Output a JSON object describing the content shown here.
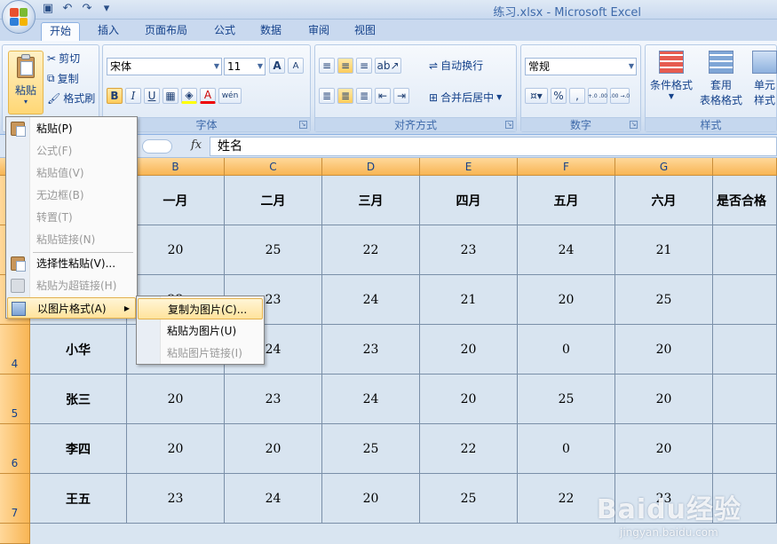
{
  "window": {
    "title": "练习.xlsx - Microsoft Excel"
  },
  "tabs": [
    "开始",
    "插入",
    "页面布局",
    "公式",
    "数据",
    "审阅",
    "视图"
  ],
  "ribbon": {
    "clipboard": {
      "paste_label": "粘贴",
      "cut_label": "剪切",
      "copy_label": "复制",
      "format_painter_label": "格式刷"
    },
    "font": {
      "group_label": "字体",
      "font_name": "宋体",
      "font_size": "11",
      "grow": "A",
      "shrink": "A",
      "bold": "B",
      "italic": "I",
      "underline": "U",
      "phonetic": "wén"
    },
    "alignment": {
      "group_label": "对齐方式",
      "wrap_text": "自动换行",
      "merge_center": "合并后居中"
    },
    "number": {
      "group_label": "数字",
      "format": "常规",
      "percent": "%",
      "comma": ",",
      "increase_decimal": "+.0 .00",
      "decrease_decimal": ".00 →.0"
    },
    "styles": {
      "group_label": "样式",
      "conditional_format_line1": "条件格式",
      "table_format_line1": "套用",
      "table_format_line2": "表格格式",
      "cell_styles_line1": "单元",
      "cell_styles_line2": "样式"
    }
  },
  "formula_bar": {
    "fx": "fx",
    "value": "姓名"
  },
  "grid": {
    "columns": [
      "B",
      "C",
      "D",
      "E",
      "F",
      "G",
      ""
    ],
    "headers": [
      "",
      "一月",
      "二月",
      "三月",
      "四月",
      "五月",
      "六月",
      "是否合格"
    ],
    "row_numbers": [
      "",
      "",
      "",
      "4",
      "5",
      "6",
      "7",
      ""
    ],
    "rows": [
      [
        "",
        "20",
        "25",
        "22",
        "23",
        "24",
        "21",
        ""
      ],
      [
        "",
        "23",
        "23",
        "24",
        "21",
        "20",
        "25",
        ""
      ],
      [
        "小华",
        "24",
        "24",
        "23",
        "20",
        "0",
        "20",
        ""
      ],
      [
        "张三",
        "20",
        "23",
        "24",
        "20",
        "25",
        "20",
        ""
      ],
      [
        "李四",
        "20",
        "20",
        "25",
        "22",
        "0",
        "20",
        ""
      ],
      [
        "王五",
        "23",
        "24",
        "20",
        "25",
        "22",
        "23",
        ""
      ]
    ]
  },
  "paste_menu": {
    "items": [
      {
        "label": "粘贴(P)",
        "enabled": true
      },
      {
        "label": "公式(F)",
        "enabled": false
      },
      {
        "label": "粘贴值(V)",
        "enabled": false
      },
      {
        "label": "无边框(B)",
        "enabled": false
      },
      {
        "label": "转置(T)",
        "enabled": false
      },
      {
        "label": "粘贴链接(N)",
        "enabled": false
      },
      {
        "label": "选择性粘贴(V)...",
        "enabled": true
      },
      {
        "label": "粘贴为超链接(H)",
        "enabled": false
      },
      {
        "label": "以图片格式(A)",
        "enabled": true
      }
    ]
  },
  "picture_menu": {
    "items": [
      {
        "label": "复制为图片(C)...",
        "enabled": true
      },
      {
        "label": "粘贴为图片(U)",
        "enabled": true
      },
      {
        "label": "粘贴图片链接(I)",
        "enabled": false
      }
    ]
  },
  "watermark": {
    "logo": "Baidu经验",
    "url": "jingyan.baidu.com"
  },
  "colors": {
    "col_header": "#f8b554",
    "cell_fill": "#d8e4f0",
    "ribbon": "#dfe9f5",
    "accent": "#15428b"
  }
}
